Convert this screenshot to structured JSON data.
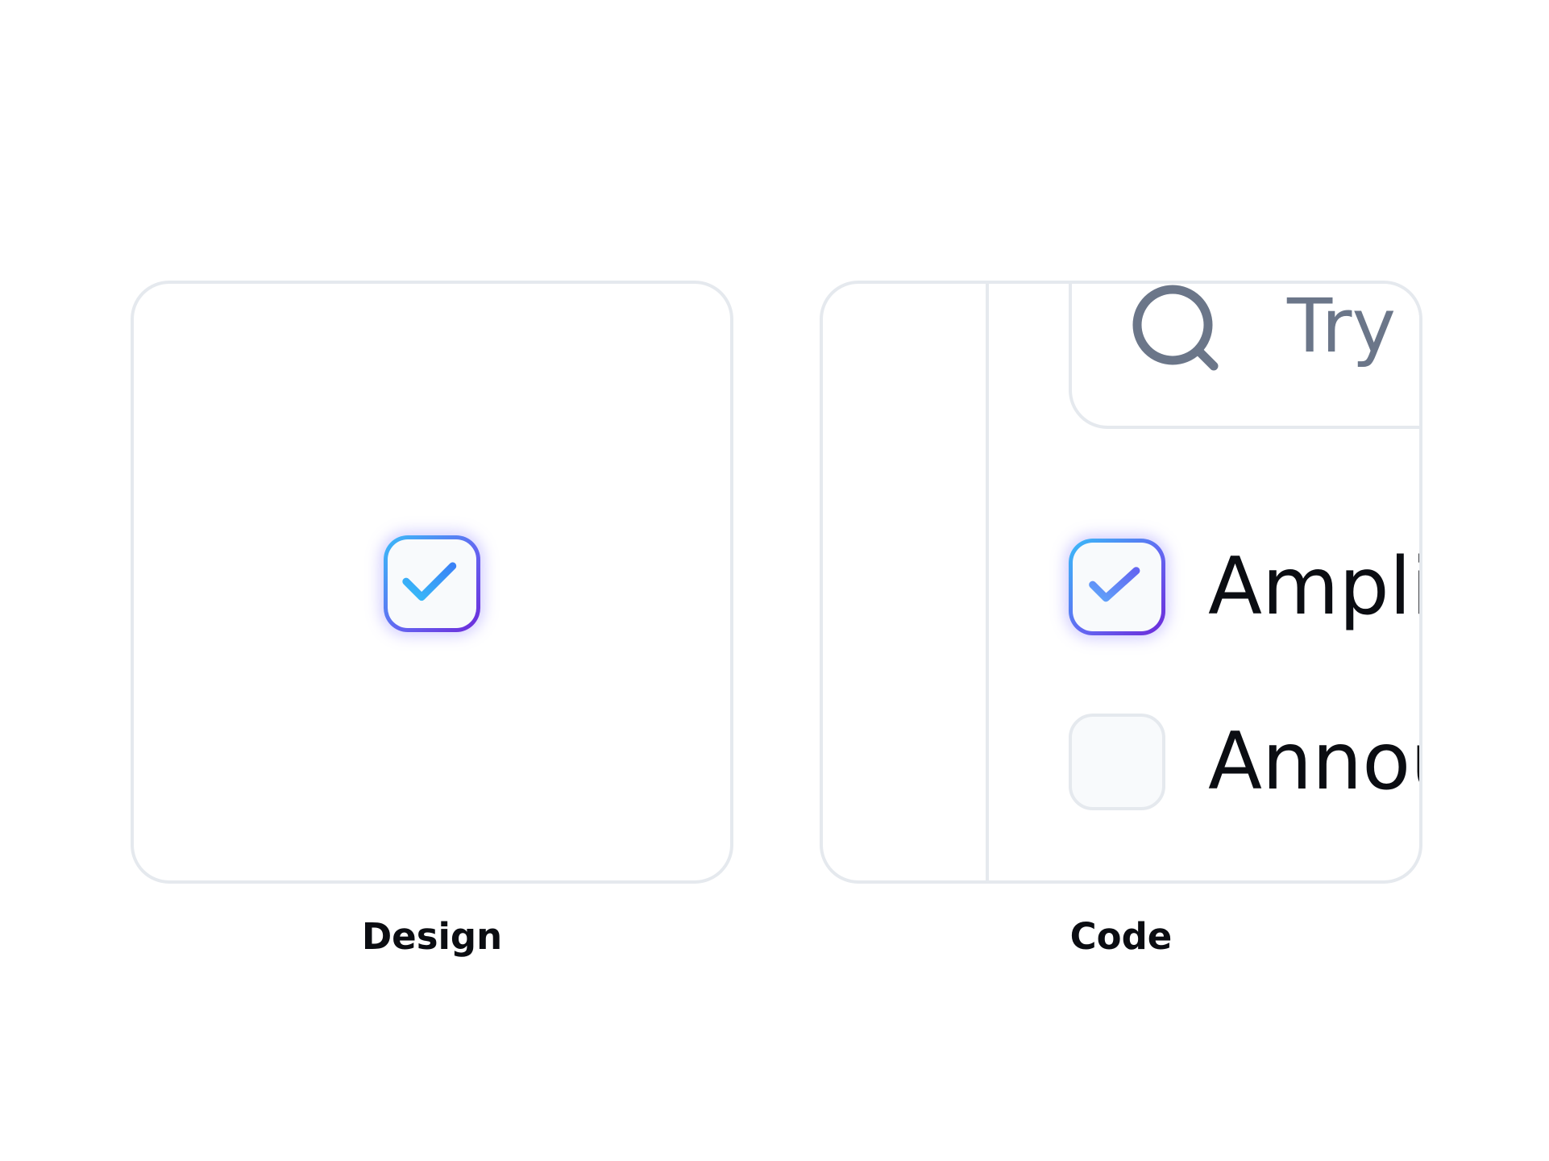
{
  "captions": {
    "design": "Design",
    "code": "Code"
  },
  "design_panel": {
    "checkbox": {
      "checked": true,
      "icon": "checkmark-icon"
    }
  },
  "code_panel": {
    "search": {
      "placeholder": "Try",
      "icon": "search-icon"
    },
    "options": [
      {
        "label": "Amplif",
        "checked": true
      },
      {
        "label": "Annou",
        "checked": false
      }
    ]
  },
  "colors": {
    "border": "#e5e9ee",
    "checkbox_fill": "#f8fafc",
    "check_gradient_start": "#38bdf8",
    "check_gradient_end": "#6d28d9",
    "text": "#0b0d12",
    "muted_text": "#6b7689"
  }
}
